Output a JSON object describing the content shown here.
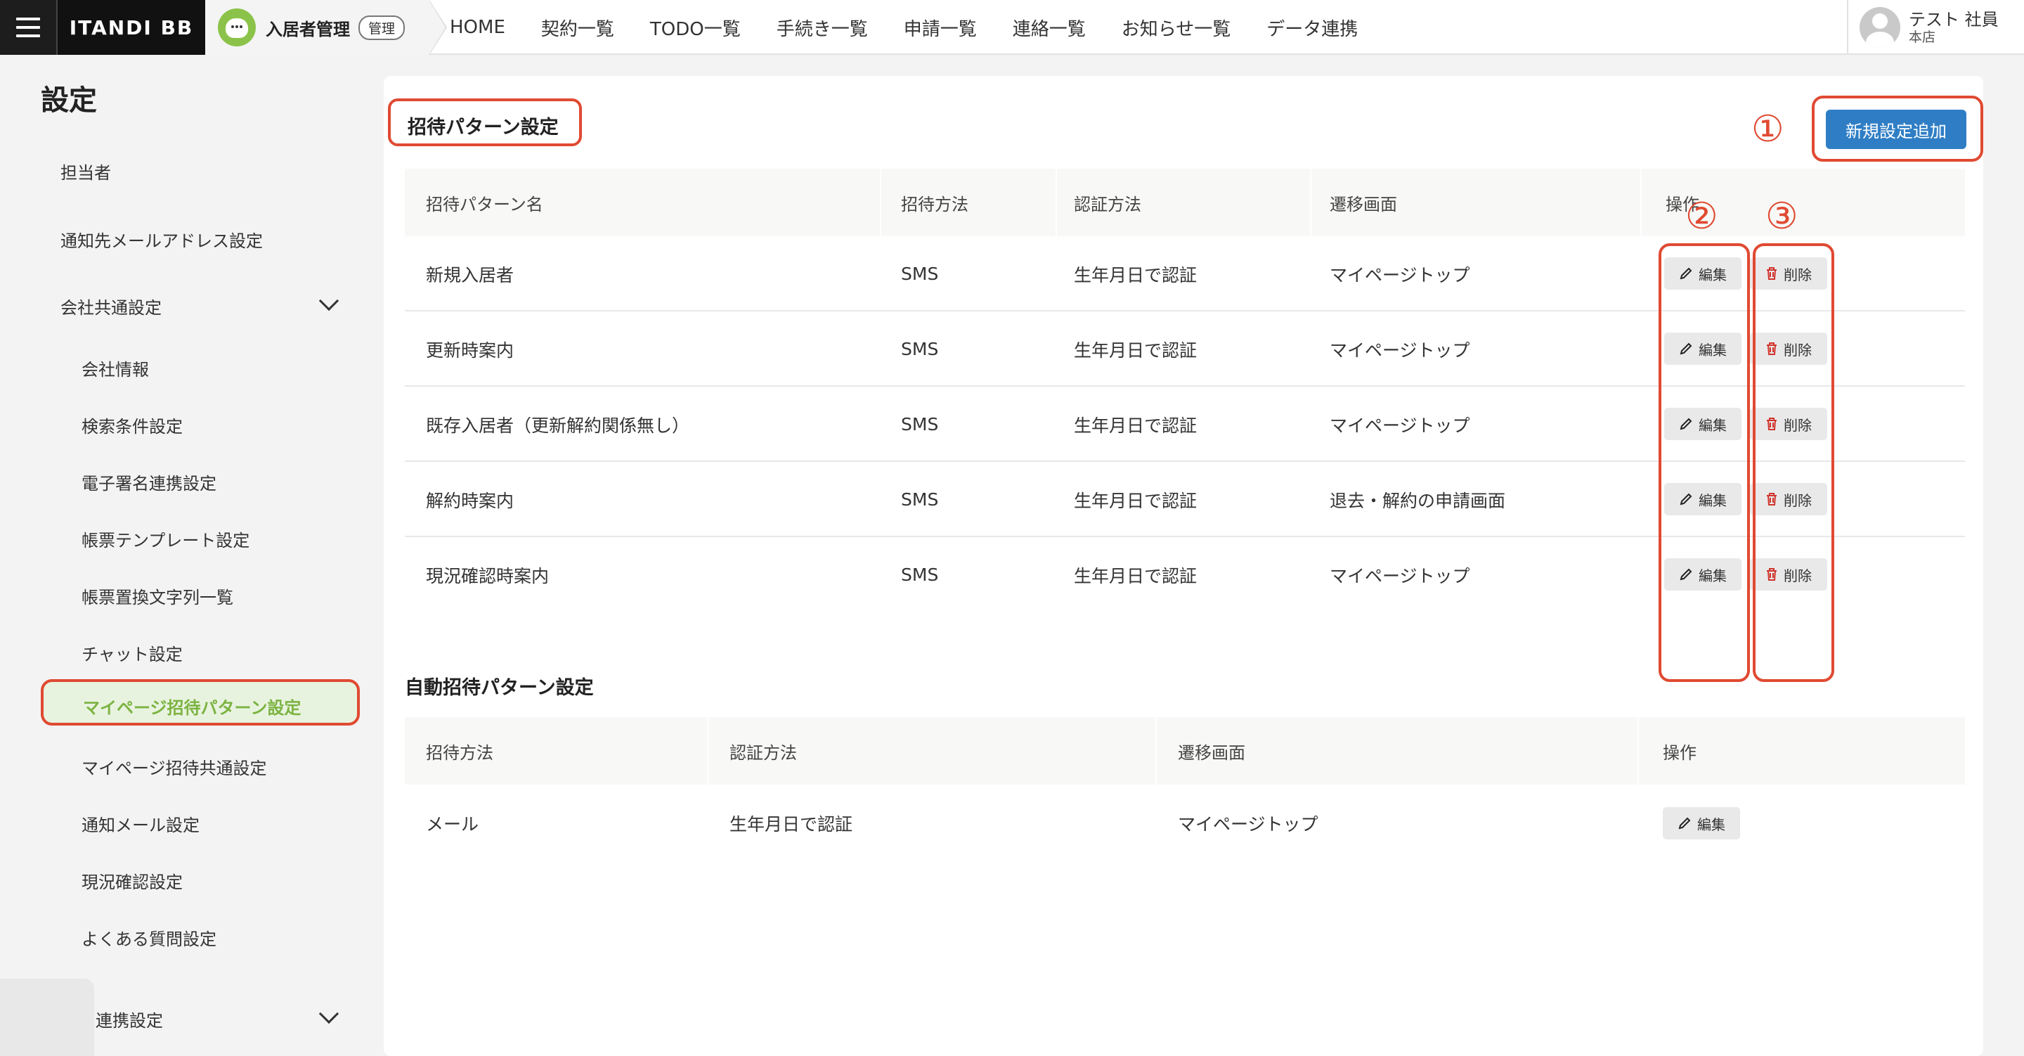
{
  "header": {
    "brand": "ITANDI BB",
    "app_name": "入居者管理",
    "app_badge": "管理",
    "nav": [
      "HOME",
      "契約一覧",
      "TODO一覧",
      "手続き一覧",
      "申請一覧",
      "連絡一覧",
      "お知らせ一覧",
      "データ連携"
    ],
    "user_name": "テスト 社員",
    "user_store": "本店"
  },
  "sidebar": {
    "title": "設定",
    "items": {
      "tantousha": "担当者",
      "mail_address": "通知先メールアドレス設定",
      "company_common": "会社共通設定",
      "company_info": "会社情報",
      "search_conditions": "検索条件設定",
      "esign": "電子署名連携設定",
      "template": "帳票テンプレート設定",
      "replace_strings": "帳票置換文字列一覧",
      "chat": "チャット設定",
      "mypage_invite_pattern": "マイページ招待パターン設定",
      "mypage_invite_common": "マイページ招待共通設定",
      "notify_mail": "通知メール設定",
      "status_check": "現況確認設定",
      "faq": "よくある質問設定",
      "integration": "連携設定"
    },
    "active_color": "#7cb342"
  },
  "main": {
    "section1_title": "招待パターン設定",
    "add_button": "新規設定追加",
    "markers": [
      "①",
      "②",
      "③"
    ],
    "table1": {
      "headers": [
        "招待パターン名",
        "招待方法",
        "認証方法",
        "遷移画面",
        "操作"
      ],
      "rows": [
        [
          "新規入居者",
          "SMS",
          "生年月日で認証",
          "マイページトップ"
        ],
        [
          "更新時案内",
          "SMS",
          "生年月日で認証",
          "マイページトップ"
        ],
        [
          "既存入居者（更新解約関係無し）",
          "SMS",
          "生年月日で認証",
          "マイページトップ"
        ],
        [
          "解約時案内",
          "SMS",
          "生年月日で認証",
          "退去・解約の申請画面"
        ],
        [
          "現況確認時案内",
          "SMS",
          "生年月日で認証",
          "マイページトップ"
        ]
      ],
      "edit_label": "編集",
      "delete_label": "削除"
    },
    "section2_title": "自動招待パターン設定",
    "table2": {
      "headers": [
        "招待方法",
        "認証方法",
        "遷移画面",
        "操作"
      ],
      "rows": [
        [
          "メール",
          "生年月日で認証",
          "マイページトップ"
        ]
      ],
      "edit_label": "編集"
    }
  },
  "colors": {
    "primary_button": "#2f7ec5",
    "annotation_red": "#e04a32",
    "delete_icon": "#d0342c"
  }
}
